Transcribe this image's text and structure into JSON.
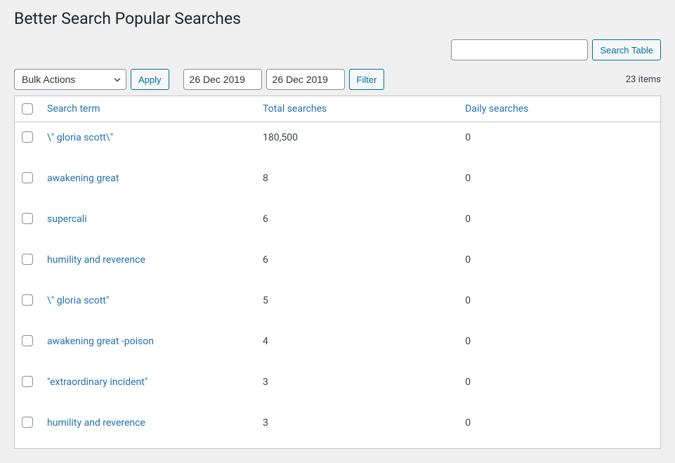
{
  "page": {
    "title": "Better Search Popular Searches"
  },
  "search": {
    "value": "",
    "button_label": "Search Table"
  },
  "toolbar": {
    "bulk_actions_label": "Bulk Actions",
    "apply_label": "Apply",
    "date_from": "26 Dec 2019",
    "date_to": "26 Dec 2019",
    "filter_label": "Filter",
    "item_count": "23 items"
  },
  "columns": {
    "search_term": "Search term",
    "total_searches": "Total searches",
    "daily_searches": "Daily searches"
  },
  "rows": [
    {
      "term": "\\\" gloria scott\\\"",
      "total": "180,500",
      "daily": "0"
    },
    {
      "term": "awakening great",
      "total": "8",
      "daily": "0"
    },
    {
      "term": "supercali",
      "total": "6",
      "daily": "0"
    },
    {
      "term": "humility and reverence",
      "total": "6",
      "daily": "0"
    },
    {
      "term": "\\\" gloria scott\"",
      "total": "5",
      "daily": "0"
    },
    {
      "term": "awakening great -poison",
      "total": "4",
      "daily": "0"
    },
    {
      "term": "\"extraordinary incident\"",
      "total": "3",
      "daily": "0"
    },
    {
      "term": "humility and reverence",
      "total": "3",
      "daily": "0"
    }
  ]
}
